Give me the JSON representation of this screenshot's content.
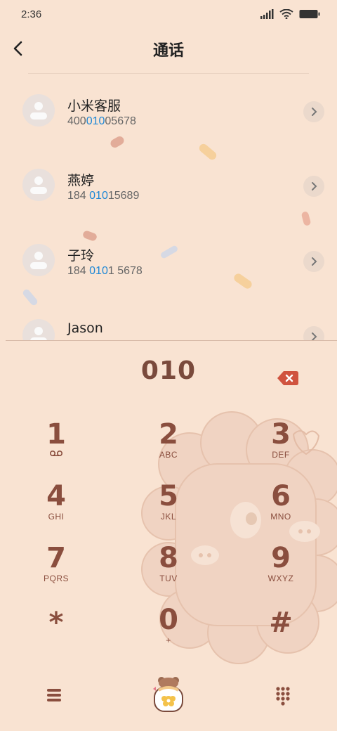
{
  "status": {
    "time": "2:36"
  },
  "header": {
    "title": "通话"
  },
  "contacts": [
    {
      "name": "小米客服",
      "number_pre": "400",
      "number_match": "010",
      "number_post": "05678"
    },
    {
      "name": "燕婷",
      "number_pre": "184 ",
      "number_match": "010",
      "number_post": "15689"
    },
    {
      "name": "子玲",
      "number_pre": "184 ",
      "number_match": "010",
      "number_post": "1 5678"
    },
    {
      "name": "Jason",
      "number_pre": "",
      "number_match": "",
      "number_post": ""
    }
  ],
  "dialer": {
    "input": "010",
    "keys": [
      {
        "digit": "1",
        "letters": ""
      },
      {
        "digit": "2",
        "letters": "ABC"
      },
      {
        "digit": "3",
        "letters": "DEF"
      },
      {
        "digit": "4",
        "letters": "GHI"
      },
      {
        "digit": "5",
        "letters": "JKL"
      },
      {
        "digit": "6",
        "letters": "MNO"
      },
      {
        "digit": "7",
        "letters": "PQRS"
      },
      {
        "digit": "8",
        "letters": "TUV"
      },
      {
        "digit": "9",
        "letters": "WXYZ"
      },
      {
        "digit": "*",
        "letters": ""
      },
      {
        "digit": "0",
        "letters": "+"
      },
      {
        "digit": "#",
        "letters": ""
      }
    ]
  },
  "colors": {
    "background": "#f9e3d2",
    "accent": "#8a4e3e",
    "highlight": "#1e88d6",
    "backspace": "#d0533f"
  },
  "icons": {
    "back": "chevron-left-icon",
    "chevron": "chevron-right-icon",
    "backspace": "backspace-icon",
    "menu": "menu-icon",
    "call": "call-icon",
    "keypad": "dialpad-icon",
    "voicemail": "voicemail-icon"
  }
}
